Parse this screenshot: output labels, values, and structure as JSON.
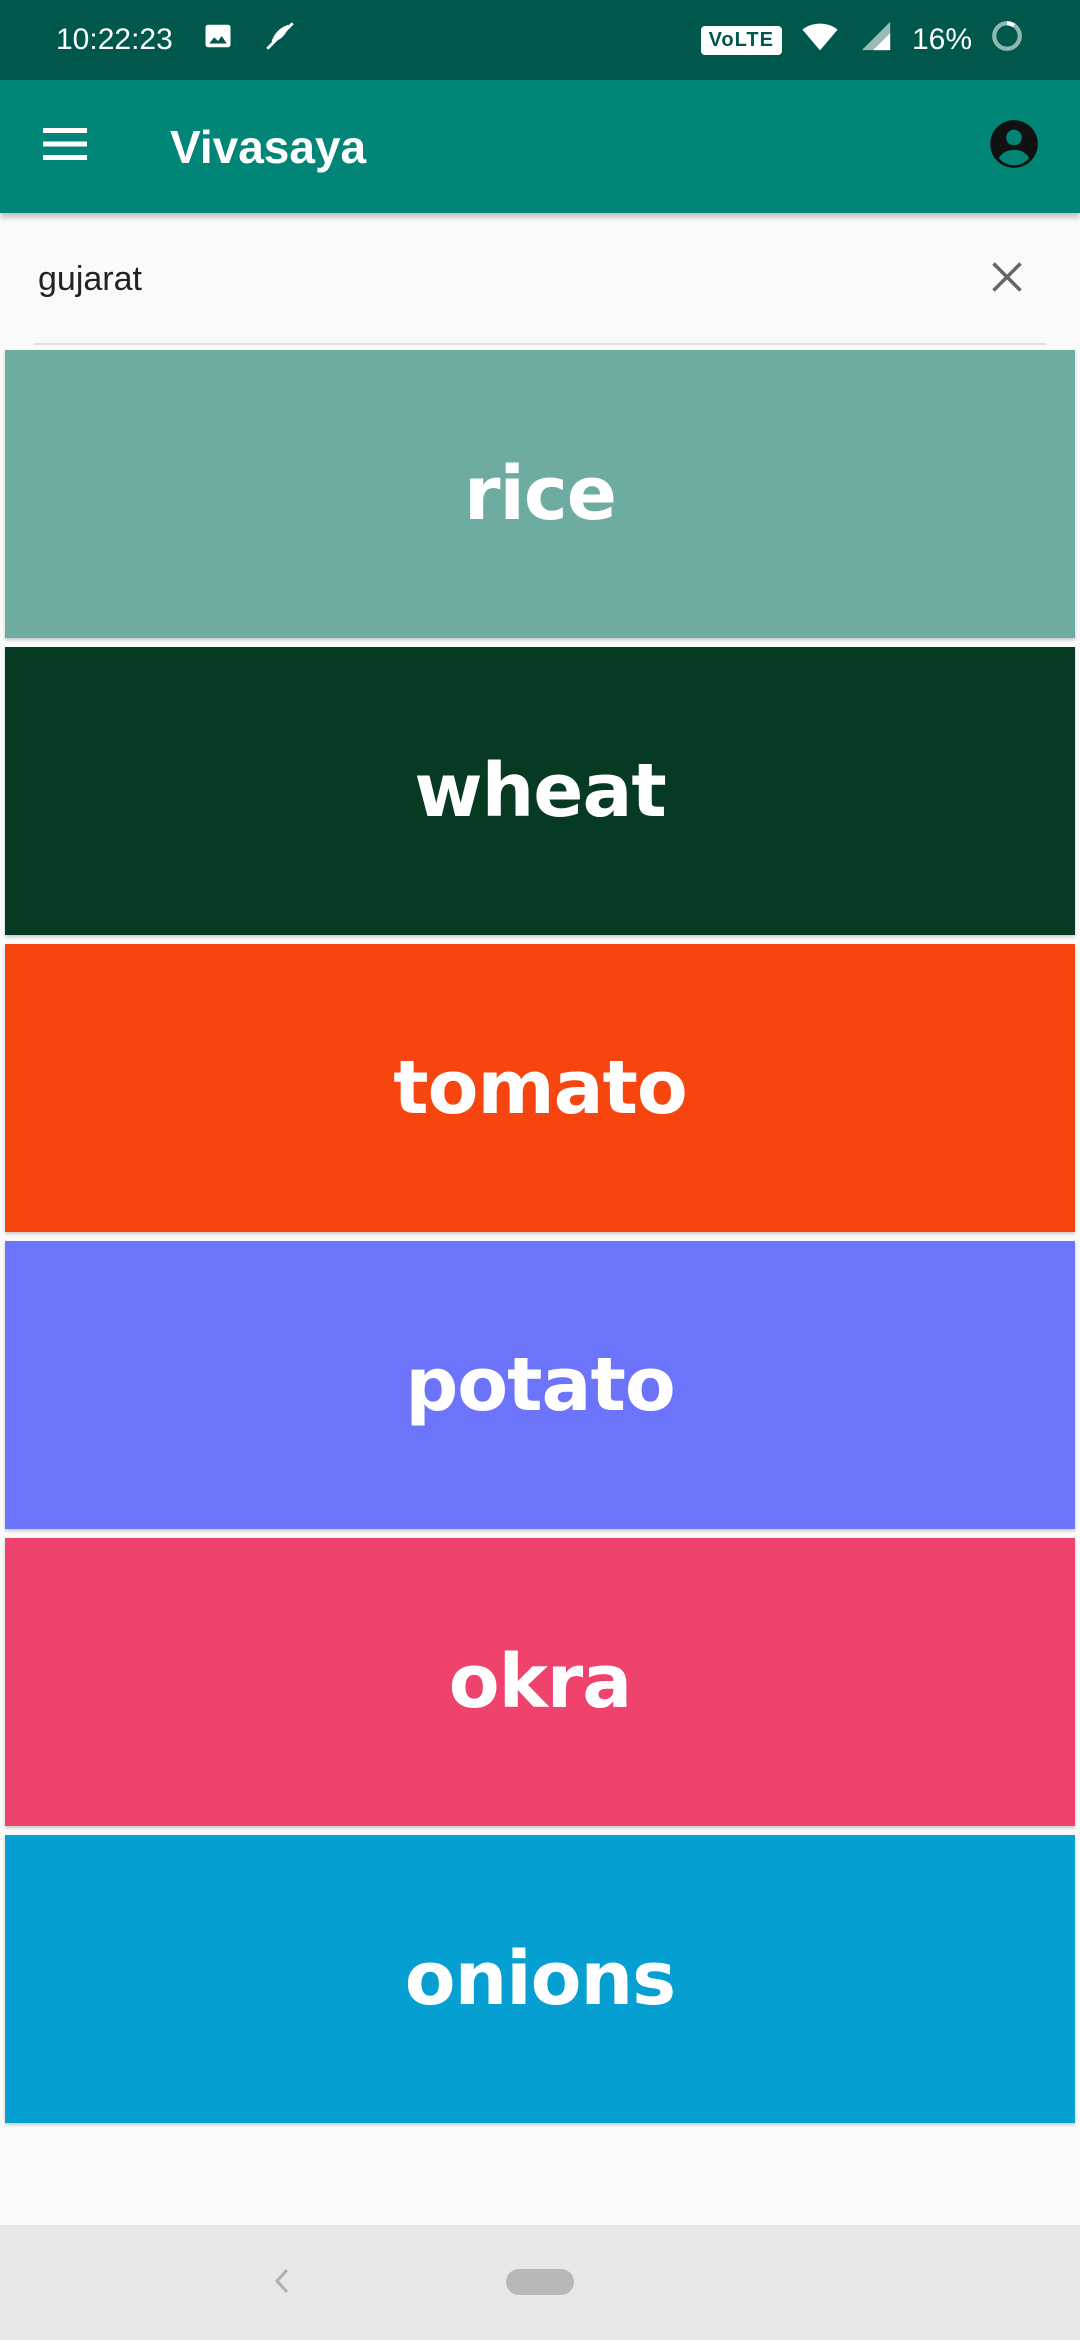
{
  "status_bar": {
    "time": "10:22:23",
    "volte": "VoLTE",
    "battery_percent": "16%",
    "icons": [
      "image-icon",
      "mute-icon",
      "wifi-icon",
      "signal-icon",
      "battery-icon"
    ]
  },
  "app_bar": {
    "title": "Vivasaya",
    "menu_icon": "hamburger-menu-icon",
    "account_icon": "account-circle-icon"
  },
  "search": {
    "value": "gujarat",
    "clear_icon": "close-icon"
  },
  "crops": [
    {
      "name": "rice",
      "color": "#6eaba0"
    },
    {
      "name": "wheat",
      "color": "#063a22"
    },
    {
      "name": "tomato",
      "color": "#f74510"
    },
    {
      "name": "potato",
      "color": "#6b74fa"
    },
    {
      "name": "okra",
      "color": "#ef426d"
    },
    {
      "name": "onions",
      "color": "#059fd1"
    }
  ],
  "colors": {
    "status_bar": "#00574b",
    "app_bar": "#008577",
    "cursor": "#d81b60"
  }
}
